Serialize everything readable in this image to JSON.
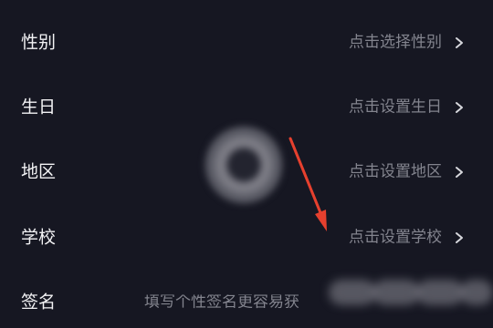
{
  "profile_rows": [
    {
      "label": "性别",
      "value": "点击选择性别"
    },
    {
      "label": "生日",
      "value": "点击设置生日"
    },
    {
      "label": "地区",
      "value": "点击设置地区"
    },
    {
      "label": "学校",
      "value": "点击设置学校"
    },
    {
      "label": "签名",
      "value": "填写个性签名更容易获"
    }
  ],
  "colors": {
    "background": "#161722",
    "label": "#f2f2f4",
    "value": "#83848e",
    "annotation_arrow": "#e6402e"
  },
  "icons": {
    "row_action": "chevron-right-icon",
    "annotation": "red-arrow-icon"
  }
}
